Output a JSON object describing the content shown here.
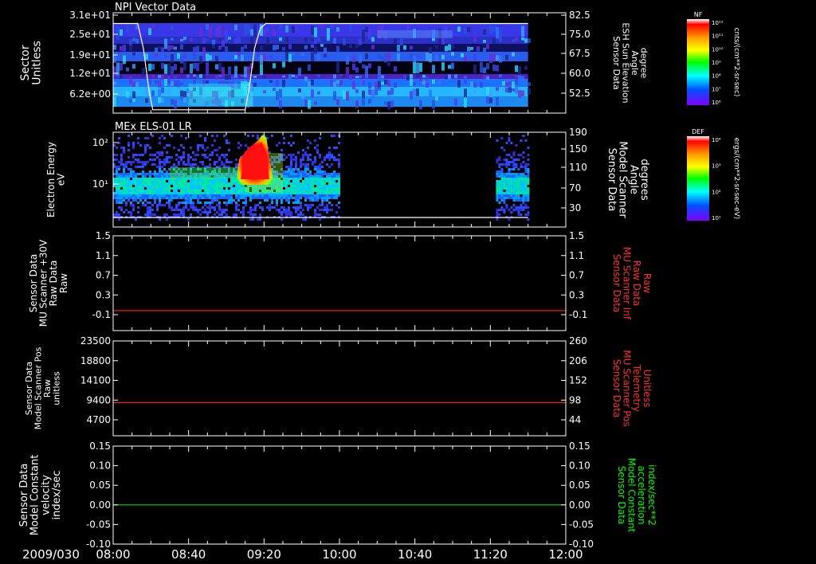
{
  "timeline": {
    "date_label": "2009/030",
    "ticks": [
      "08:00",
      "08:40",
      "09:20",
      "10:00",
      "10:40",
      "11:20",
      "12:00"
    ],
    "start_min": 480,
    "end_min": 720
  },
  "colors": {
    "red_line": "#ff2020",
    "green_line": "#00e000",
    "red_text": "#ff3030",
    "green_text": "#00ff00"
  },
  "chart_data": [
    {
      "type": "heatmap",
      "title": "NPI Vector Data",
      "ylabel": [
        "Sector",
        "Unitless"
      ],
      "y_ticks": [
        "3.1e+01",
        "2.5e+01",
        "1.9e+01",
        "1.2e+01",
        "6.2e+00"
      ],
      "right_ylabel": [
        "Sensor Data",
        "ESH Sun Elevation",
        "Angle",
        "degree"
      ],
      "right_ticks": [
        "82.5",
        "75.0",
        "67.5",
        "60.0",
        "52.5"
      ],
      "overlay_line": {
        "name": "ESH Sun Elevation Angle",
        "x": [
          "08:00",
          "08:13",
          "08:16",
          "08:19",
          "08:21",
          "09:10",
          "09:12",
          "09:15",
          "09:18",
          "09:21",
          "11:40"
        ],
        "y": [
          82,
          82,
          72,
          55,
          47,
          47,
          55,
          72,
          80,
          82,
          82
        ]
      },
      "colorbar": {
        "label": "NF",
        "units": "cnts/(cm**2-sr-sec)",
        "ticks": [
          "10¹²",
          "10¹¹",
          "10¹⁰",
          "10⁹",
          "10⁸",
          "10⁷",
          "10⁶"
        ]
      }
    },
    {
      "type": "heatmap",
      "title": "MEx ELS-01 LR",
      "ylabel": [
        "Electron Energy",
        "eV"
      ],
      "y_ticks": [
        "10²",
        "10¹"
      ],
      "right_ylabel": [
        "Sensor Data",
        "Model Scanner",
        "Angle",
        "degrees"
      ],
      "right_ticks": [
        "190",
        "150",
        "110",
        "70",
        "30"
      ],
      "data_gap": [
        "10:00",
        "11:23"
      ],
      "overlay_line": {
        "name": "Model Scanner Angle",
        "x": [
          "08:00",
          "11:40"
        ],
        "y": [
          10,
          10
        ]
      },
      "colorbar": {
        "label": "DEF",
        "units": "ergs/(cm**2-sr-sec-eV)",
        "ticks": [
          "10⁴",
          "10³",
          "10²",
          "10¹"
        ]
      }
    },
    {
      "type": "line",
      "ylabel": [
        "Sensor Data",
        "MU Scanner +30V",
        "Raw Data",
        "Raw"
      ],
      "y_ticks": [
        "1.5",
        "1.1",
        "0.7",
        "0.3",
        "-0.1"
      ],
      "ylim": [
        -0.4,
        1.5
      ],
      "right_ylabel": [
        "Sensor Data",
        "MU Scanner Inf",
        "Raw Data",
        "Raw"
      ],
      "right_ticks": [
        "1.5",
        "1.1",
        "0.7",
        "0.3",
        "-0.1"
      ],
      "series": [
        {
          "color": "red",
          "x": [
            "08:00",
            "12:00"
          ],
          "y": [
            0,
            0
          ]
        }
      ]
    },
    {
      "type": "line",
      "ylabel": [
        "Sensor Data",
        "Model Scanner Pos",
        "Raw",
        "unitless"
      ],
      "y_ticks": [
        "23500",
        "18800",
        "14100",
        "9400",
        "4700"
      ],
      "ylim": [
        0,
        23500
      ],
      "right_ylabel": [
        "Sensor Data",
        "MU Scanner Pos",
        "Telemetry",
        "Unitless"
      ],
      "right_ticks": [
        "260",
        "206",
        "152",
        "98",
        "44"
      ],
      "series": [
        {
          "color": "red",
          "x": [
            "08:00",
            "12:00"
          ],
          "y": [
            8200,
            8200
          ]
        }
      ]
    },
    {
      "type": "line",
      "ylabel": [
        "Sensor Data",
        "Model Constant",
        "velocity",
        "index/sec"
      ],
      "y_ticks": [
        "0.15",
        "0.10",
        "0.05",
        "0.00",
        "-0.05",
        "-0.10"
      ],
      "ylim": [
        -0.1,
        0.15
      ],
      "right_ylabel": [
        "Sensor Data",
        "Model Constant",
        "acceleration",
        "index/sec**2"
      ],
      "right_ticks": [
        "0.15",
        "0.10",
        "0.05",
        "0.00",
        "-0.05",
        "-0.10"
      ],
      "series": [
        {
          "color": "green",
          "x": [
            "08:00",
            "12:00"
          ],
          "y": [
            0,
            0
          ]
        }
      ]
    }
  ]
}
